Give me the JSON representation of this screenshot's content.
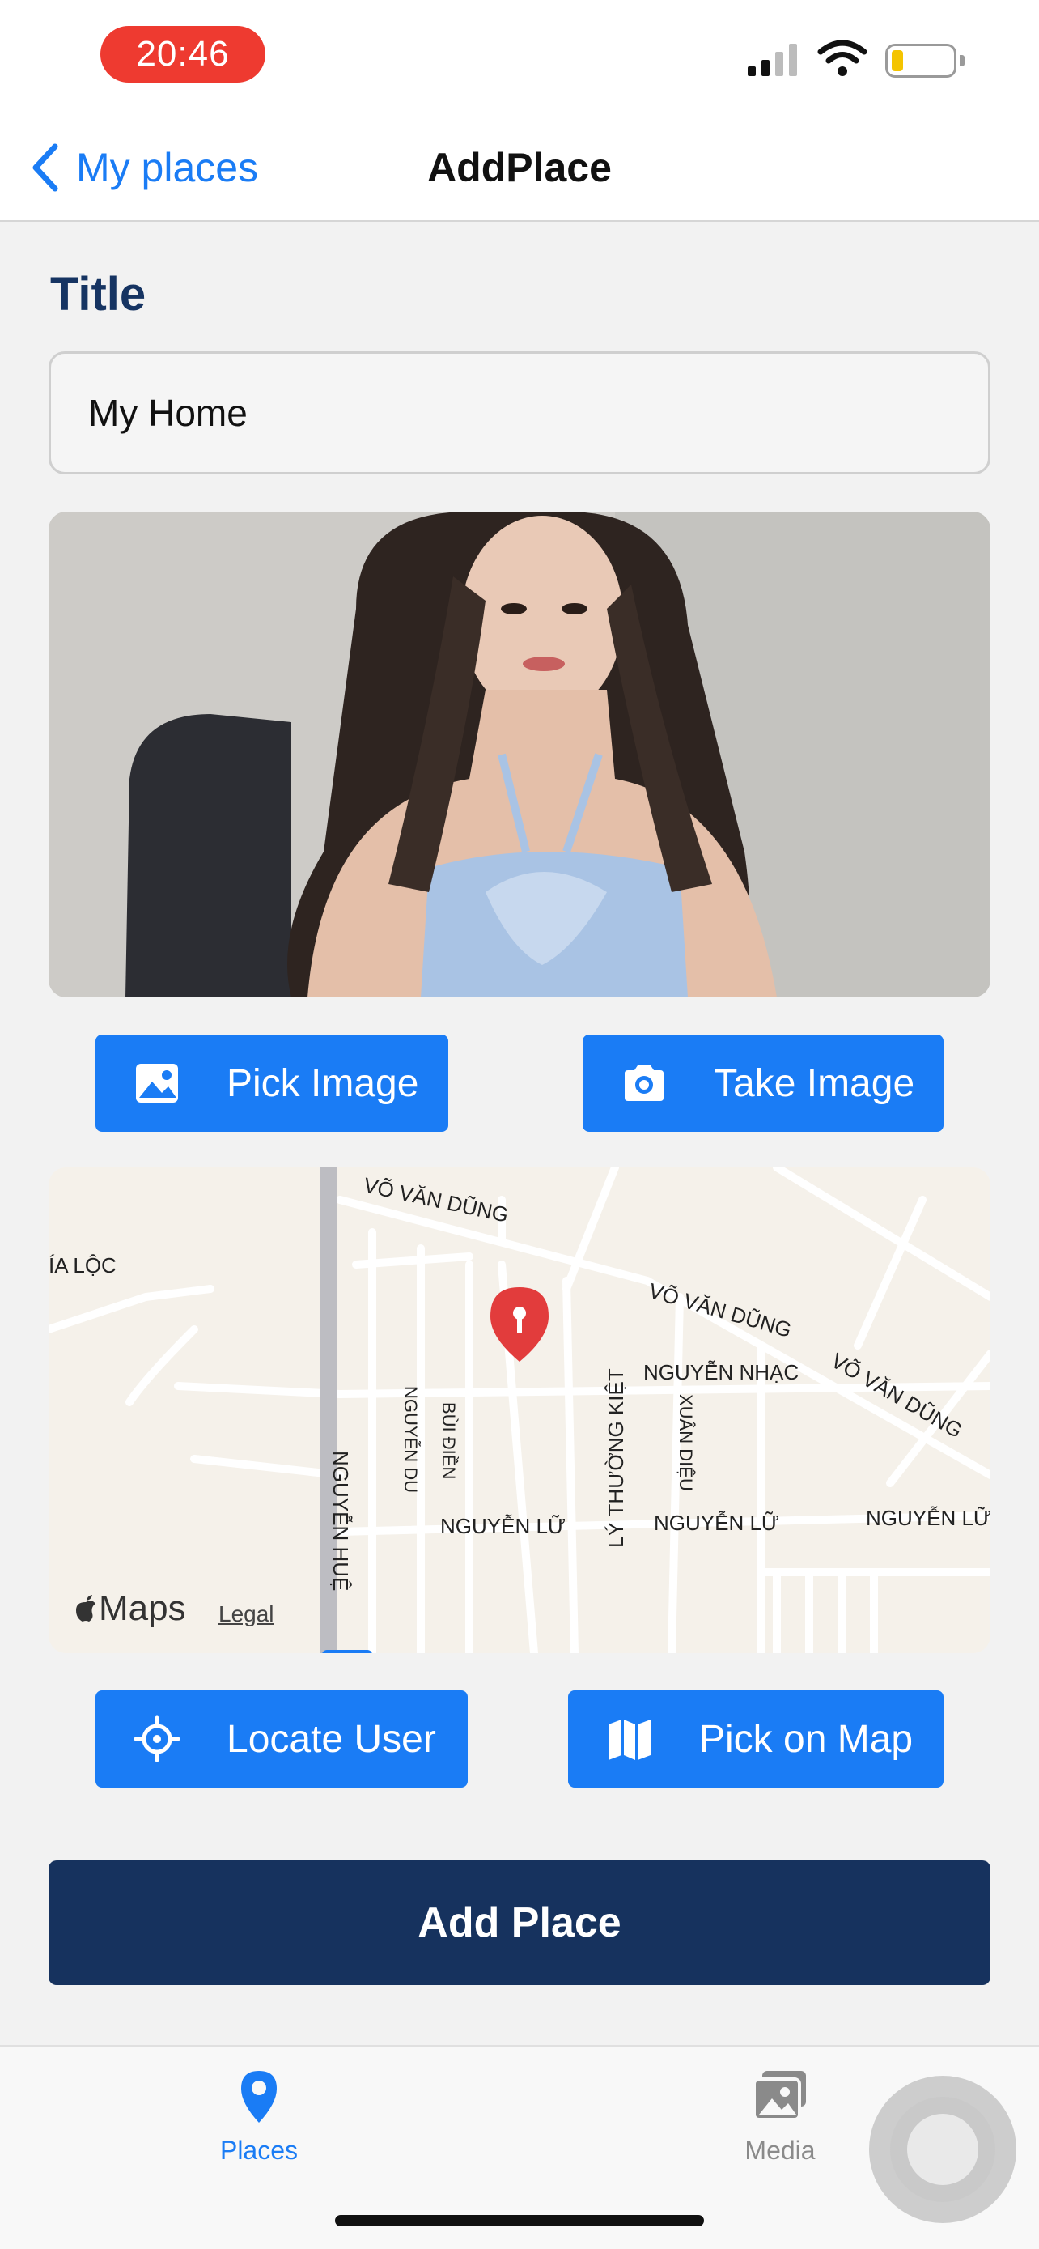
{
  "status_bar": {
    "time": "20:46",
    "icons": [
      "signal-icon",
      "wifi-icon",
      "battery-icon"
    ]
  },
  "nav": {
    "back_label": "My places",
    "title": "AddPlace"
  },
  "form": {
    "title_label": "Title",
    "title_value": "My Home"
  },
  "buttons": {
    "pick_image": "Pick Image",
    "take_image": "Take Image",
    "locate_user": "Locate User",
    "pick_on_map": "Pick on Map",
    "add_place": "Add Place"
  },
  "map": {
    "logo": "Maps",
    "legal": "Legal",
    "street_labels": [
      "VÕ VĂN DŨNG",
      "VÕ VĂN DŨNG",
      "VÕ VĂN DŨNG",
      "ÍA LỘC",
      "NGUYỄN NHẠC",
      "NGUYỄN DU",
      "BÙI ĐIỀN",
      "LÝ THƯỜNG KIỆT",
      "XUÂN DIỆU",
      "NGUYỄN HUỆ",
      "NGUYỄN LỮ",
      "NGUYỄN LỮ",
      "NGUYỄN LỮ"
    ]
  },
  "tabs": [
    {
      "label": "Places",
      "icon": "map-pin-icon",
      "active": true
    },
    {
      "label": "Media",
      "icon": "images-icon",
      "active": false
    }
  ],
  "colors": {
    "accent": "#1a7cf5",
    "primary_dark": "#16325e",
    "title_label": "#163462",
    "time_pill": "#ee3a30",
    "map_pin": "#e23c3c"
  }
}
